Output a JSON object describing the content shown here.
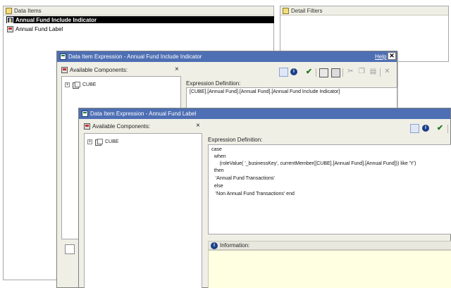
{
  "data_items": {
    "header": "Data Items",
    "items": [
      "Annual Fund Include Indicator",
      "Annual Fund Label"
    ]
  },
  "detail_filters": {
    "header": "Detail Filters"
  },
  "dialog1": {
    "title": "Data Item Expression - Annual Fund Include Indicator",
    "help": "Help",
    "available_components": "Available Components:",
    "cube": "CUBE",
    "expression_label": "Expression Definition:",
    "expression": "[CUBE].[Annual Fund].[Annual Fund].[Annual Fund Include Indicator]"
  },
  "dialog2": {
    "title": "Data Item Expression - Annual Fund Label",
    "available_components": "Available Components:",
    "cube": "CUBE",
    "expression_label": "Expression Definition:",
    "expression_lines": [
      "case",
      "  when",
      "      (roleValue( '_businessKey', currentMember([CUBE].[Annual Fund].[Annual Fund])) like 'Y')",
      "  then",
      "   'Annual Fund Transactions'",
      "  else",
      "   'Non Annual Fund Transactions' end"
    ],
    "information_label": "Information:"
  },
  "colors": {
    "titlebar": "#4e6fb4",
    "dialog_bg": "#f0efe6",
    "info_bg": "#ffffe1",
    "selection": "#000000"
  }
}
